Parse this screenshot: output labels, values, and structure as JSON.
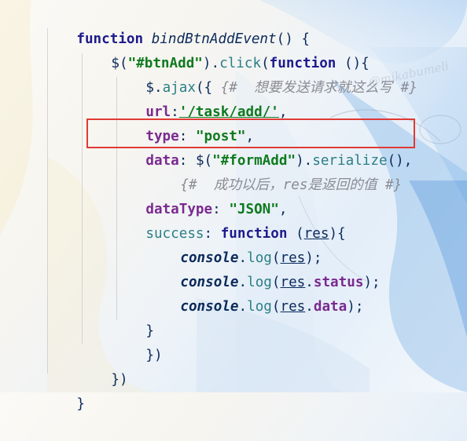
{
  "code": {
    "l1": {
      "kw": "function",
      "name": "bindBtnAddEvent",
      "tail": "() {"
    },
    "l2": {
      "a": "$(",
      "sel": "\"#btnAdd\"",
      "b": ").",
      "method": "click",
      "c": "(",
      "kw": "function",
      "d": " (){"
    },
    "l3": {
      "a": "$.",
      "method": "ajax",
      "b": "({ ",
      "comment": "{#  想要发送请求就这么写 #}"
    },
    "l4": {
      "prop": "url",
      "colon": ":",
      "val": "'/task/add/'",
      "comma": ","
    },
    "l5": {
      "prop": "type",
      "colon": ": ",
      "val": "\"post\"",
      "comma": ","
    },
    "l6": {
      "prop": "data",
      "colon": ": ",
      "a": "$(",
      "sel": "\"#formAdd\"",
      "b": ").",
      "method": "serialize",
      "c": "(),"
    },
    "l7": {
      "comment": "{#  成功以后，res是返回的值 #}"
    },
    "l8": {
      "prop": "dataType",
      "colon": ": ",
      "val": "\"JSON\"",
      "comma": ","
    },
    "l9": {
      "prop": "success",
      "colon": ": ",
      "kw": "function",
      "sp": " ",
      "arg": "res",
      "tail": "){"
    },
    "l10": {
      "obj": "console",
      "dot": ".",
      "method": "log",
      "a": "(",
      "arg": "res",
      "b": ");"
    },
    "l11": {
      "obj": "console",
      "dot": ".",
      "method": "log",
      "a": "(",
      "arg": "res",
      "dot2": ".",
      "prop": "status",
      "b": ");"
    },
    "l12": {
      "obj": "console",
      "dot": ".",
      "method": "log",
      "a": "(",
      "arg": "res",
      "dot2": ".",
      "prop": "data",
      "b": ");"
    },
    "l13": {
      "text": "}"
    },
    "l14": {
      "text": "})"
    },
    "l15": {
      "text": "})"
    },
    "l16": {
      "text": "}"
    }
  },
  "watermark": "@mikabumeli",
  "colors": {
    "highlight": "#e03a34",
    "keyword": "#1d1b8c",
    "string": "#0f7a1f",
    "property": "#7a2a8f",
    "comment": "#8a8c94"
  }
}
